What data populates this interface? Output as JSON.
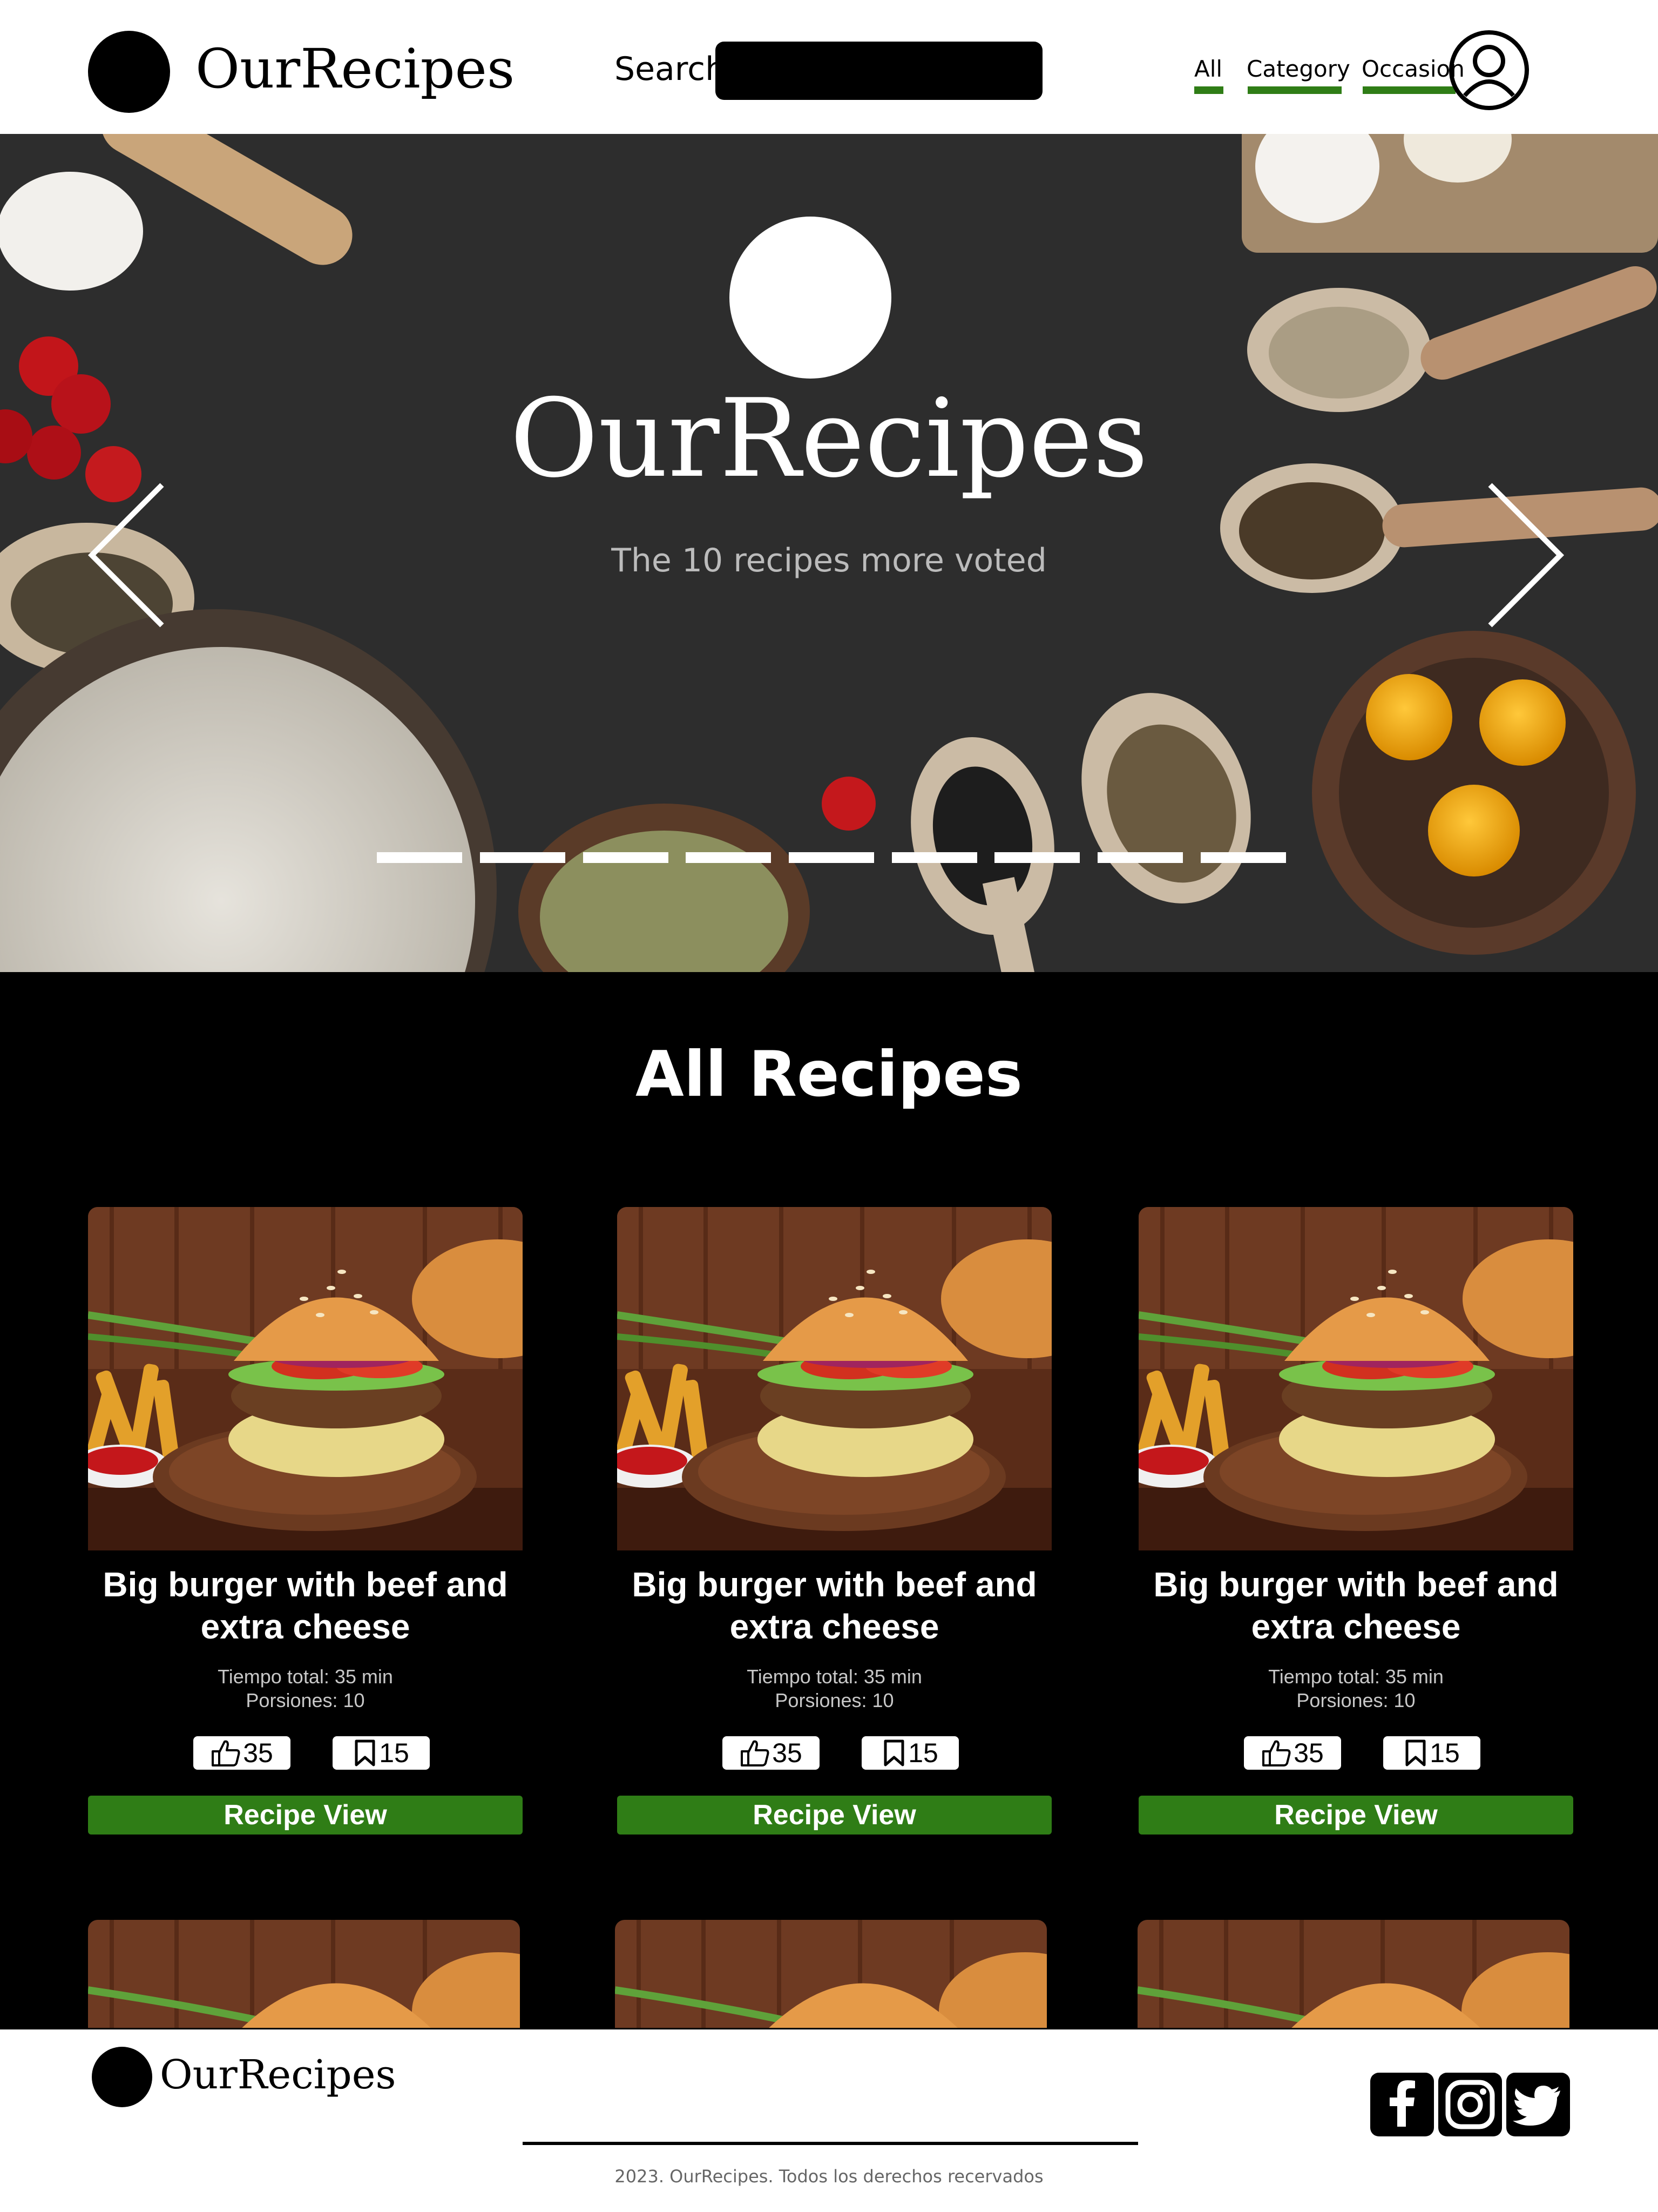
{
  "header": {
    "logo_text": "OurRecipes",
    "search_label": "Search",
    "search_placeholder": "",
    "nav": [
      "All",
      "Category",
      "Occasion"
    ],
    "account_icon": "user-circle-icon"
  },
  "hero": {
    "title": "OurRecipes",
    "subtitle": "The 10 recipes more voted",
    "slide_count": 9,
    "prev_icon": "chevron-left-icon",
    "next_icon": "chevron-right-icon"
  },
  "section": {
    "title": "All Recipes"
  },
  "recipes": [
    {
      "title": "Big burger with beef and extra cheese",
      "total_time": "Tiempo total: 35 min",
      "servings": "Porsiones: 10",
      "likes": "35",
      "saves": "15",
      "button": "Recipe View"
    },
    {
      "title": "Big burger with beef and extra cheese",
      "total_time": "Tiempo total: 35 min",
      "servings": "Porsiones: 10",
      "likes": "35",
      "saves": "15",
      "button": "Recipe View"
    },
    {
      "title": "Big burger with beef and extra cheese",
      "total_time": "Tiempo total: 35 min",
      "servings": "Porsiones: 10",
      "likes": "35",
      "saves": "15",
      "button": "Recipe View"
    }
  ],
  "footer": {
    "logo_text": "OurRecipes",
    "copyright": "2023. OurRecipes. Todos los derechos recervados",
    "social": [
      "facebook-icon",
      "instagram-icon",
      "twitter-icon"
    ]
  },
  "colors": {
    "accent_green": "#2f7d16",
    "background": "#000000",
    "header_bg": "#ffffff"
  }
}
